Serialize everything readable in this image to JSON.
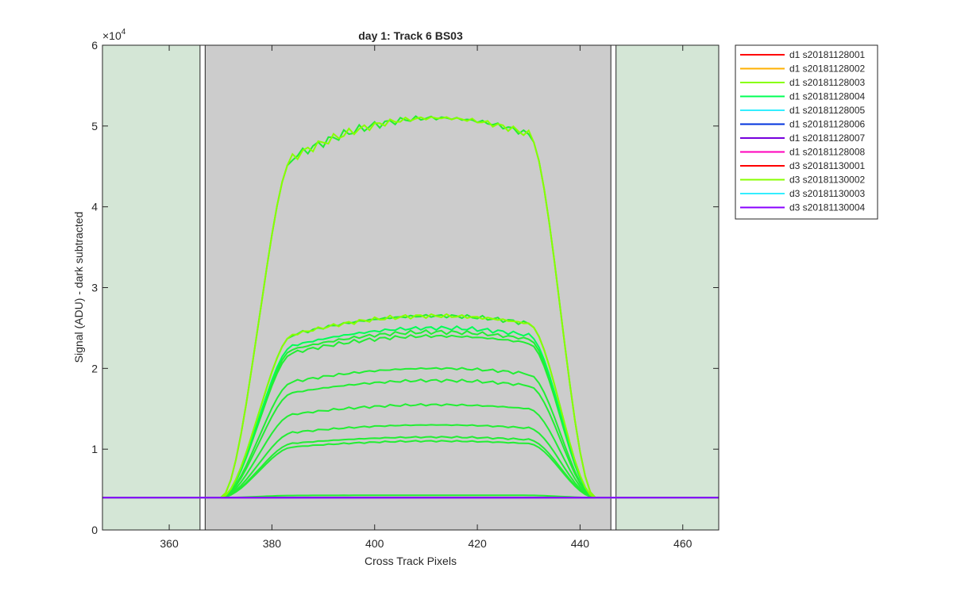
{
  "chart_data": {
    "type": "line",
    "title": "day 1: Track 6  BS03",
    "xlabel": "Cross Track Pixels",
    "ylabel": "Signal (ADU) - dark subtracted",
    "exponent_label": "×10",
    "exponent_power": "4",
    "xlim": [
      347,
      467
    ],
    "ylim": [
      0,
      60000
    ],
    "xticks": [
      360,
      380,
      400,
      420,
      440,
      460
    ],
    "yticks": [
      0,
      10000,
      20000,
      30000,
      40000,
      50000,
      60000
    ],
    "ytick_labels": [
      "0",
      "1",
      "2",
      "3",
      "4",
      "5",
      "6"
    ],
    "grid": false,
    "legend_position": "outside-right",
    "shaded_regions": [
      {
        "x0": 347,
        "x1": 366,
        "color": "#d4e6d6"
      },
      {
        "x0": 367,
        "x1": 446,
        "color": "#cccccc"
      },
      {
        "x0": 447,
        "x1": 467,
        "color": "#d4e6d6"
      }
    ],
    "baseline": 4000,
    "series": [
      {
        "name": "d1 s20181128001",
        "color": "#ff0000",
        "plateau": 4000
      },
      {
        "name": "d1 s20181128002",
        "color": "#ffb000",
        "plateau": 4000
      },
      {
        "name": "d1 s20181128003",
        "color": "#88ff00",
        "plateau": 51000
      },
      {
        "name": "d1 s20181128004",
        "color": "#00ff55",
        "plateau": 25000
      },
      {
        "name": "d1 s20181128005",
        "color": "#33eeff",
        "plateau": 4000
      },
      {
        "name": "d1 s20181128006",
        "color": "#0033dd",
        "plateau": 4000
      },
      {
        "name": "d1 s20181128007",
        "color": "#7700dd",
        "plateau": 4000
      },
      {
        "name": "d1 s20181128008",
        "color": "#ff00bb",
        "plateau": 4000
      },
      {
        "name": "d3 s20181130001",
        "color": "#ff0000",
        "plateau": 4000
      },
      {
        "name": "d3 s20181130002",
        "color": "#88ff00",
        "plateau": 26500
      },
      {
        "name": "d3 s20181130003",
        "color": "#33eeff",
        "plateau": 4000
      },
      {
        "name": "d3 s20181130004",
        "color": "#8800ff",
        "plateau": 4000
      }
    ],
    "extra_traces": [
      {
        "color": "#22ee33",
        "plateau": 51000
      },
      {
        "color": "#22ee33",
        "plateau": 26500
      },
      {
        "color": "#22ee33",
        "plateau": 24500
      },
      {
        "color": "#22ee33",
        "plateau": 24000
      },
      {
        "color": "#22ee33",
        "plateau": 20000
      },
      {
        "color": "#22ee33",
        "plateau": 18500
      },
      {
        "color": "#22ee33",
        "plateau": 15500
      },
      {
        "color": "#22ee33",
        "plateau": 13000
      },
      {
        "color": "#22ee33",
        "plateau": 11500
      },
      {
        "color": "#22ee33",
        "plateau": 11000
      },
      {
        "color": "#22ee33",
        "plateau": 4300
      }
    ]
  }
}
